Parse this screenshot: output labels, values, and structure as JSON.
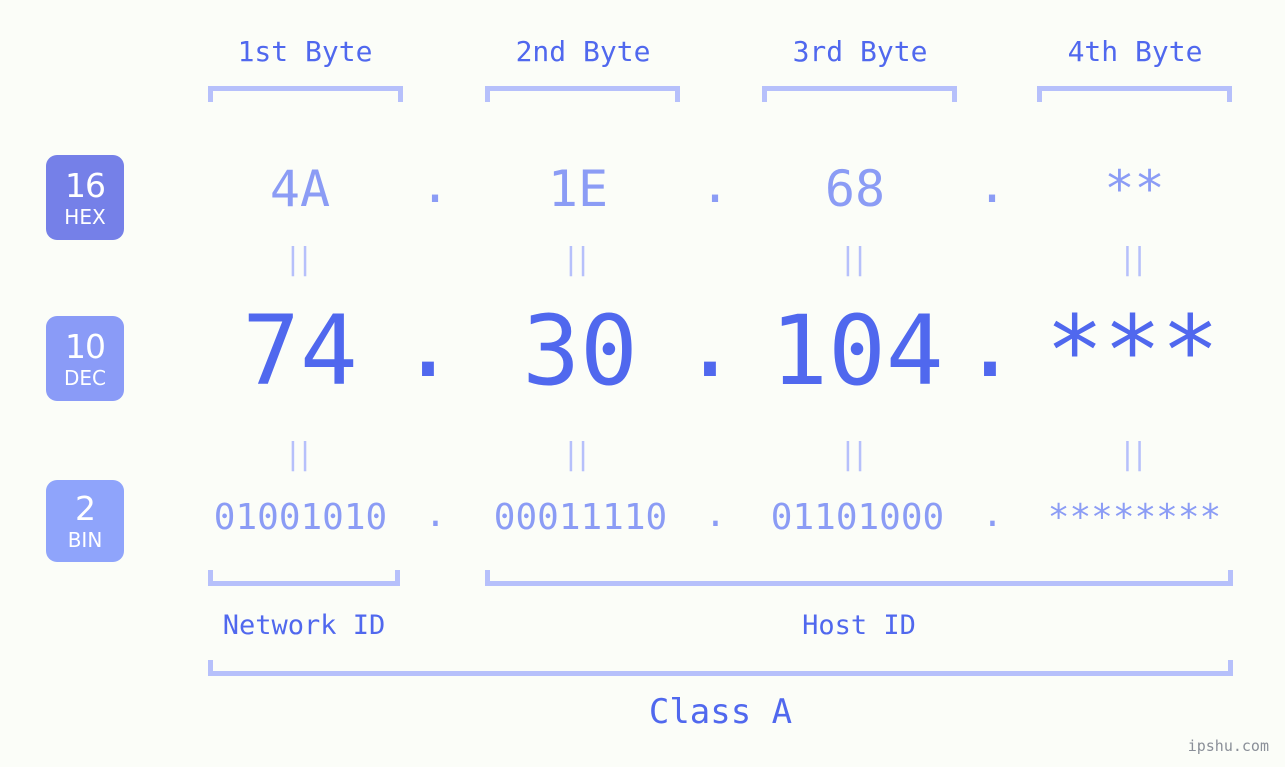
{
  "background_color": "#fbfdf8",
  "colors": {
    "accent_strong": "#5068ee",
    "accent_light": "#8b9cf5",
    "bracket": "#b6c0fb",
    "badge_hex": "#7580e8",
    "badge_dec": "#8a9bf7",
    "badge_bin": "#8fa4fb",
    "watermark": "#8a8f98"
  },
  "headers": [
    {
      "label": "1st Byte"
    },
    {
      "label": "2nd Byte"
    },
    {
      "label": "3rd Byte"
    },
    {
      "label": "4th Byte"
    }
  ],
  "rows": {
    "hex": {
      "badge_number": "16",
      "badge_name": "HEX",
      "bytes": [
        "4A",
        "1E",
        "68",
        "**"
      ],
      "separator": "."
    },
    "dec": {
      "badge_number": "10",
      "badge_name": "DEC",
      "bytes": [
        "74",
        "30",
        "104",
        "***"
      ],
      "separator": "."
    },
    "bin": {
      "badge_number": "2",
      "badge_name": "BIN",
      "bytes": [
        "01001010",
        "00011110",
        "01101000",
        "********"
      ],
      "separator": "."
    }
  },
  "equivalence_mark": "||",
  "segments": {
    "network_id": "Network ID",
    "host_id": "Host ID",
    "class": "Class A"
  },
  "watermark": "ipshu.com"
}
